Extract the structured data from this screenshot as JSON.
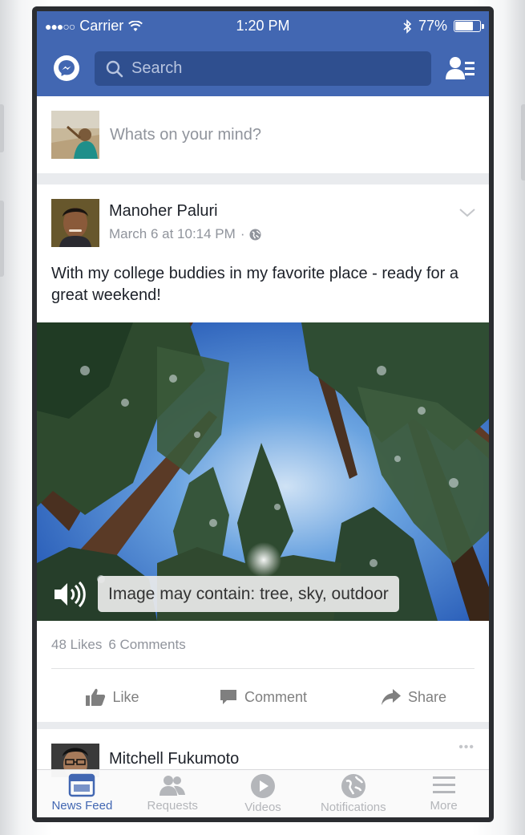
{
  "status_bar": {
    "signal": "●●●○○",
    "carrier": "Carrier",
    "time": "1:20 PM",
    "battery": "77%",
    "battery_level": 0.77
  },
  "header": {
    "messenger_icon": "messenger-icon",
    "search_placeholder": "Search",
    "friend_requests_icon": "friend-requests-icon"
  },
  "composer": {
    "prompt": "Whats on your mind?"
  },
  "post": {
    "author": "Manoher Paluri",
    "timestamp": "March 6 at 10:14 PM",
    "separator": "·",
    "privacy_icon": "globe-icon",
    "text": "With my college buddies in my favorite place - ready for a great weekend!",
    "photo_alt": "Image may contain: tree, sky, outdoor",
    "likes": "48 Likes",
    "comments": "6 Comments",
    "actions": {
      "like": "Like",
      "comment": "Comment",
      "share": "Share"
    }
  },
  "next_post": {
    "author": "Mitchell Fukumoto",
    "more": "•••"
  },
  "tabs": [
    {
      "label": "News Feed",
      "icon": "news-feed-icon",
      "active": true
    },
    {
      "label": "Requests",
      "icon": "requests-icon",
      "active": false
    },
    {
      "label": "Videos",
      "icon": "videos-icon",
      "active": false
    },
    {
      "label": "Notifications",
      "icon": "notifications-icon",
      "active": false
    },
    {
      "label": "More",
      "icon": "more-icon",
      "active": false
    }
  ],
  "colors": {
    "brand": "#4267b2",
    "search_bg": "#2f4f8f",
    "muted_text": "#90949c"
  }
}
